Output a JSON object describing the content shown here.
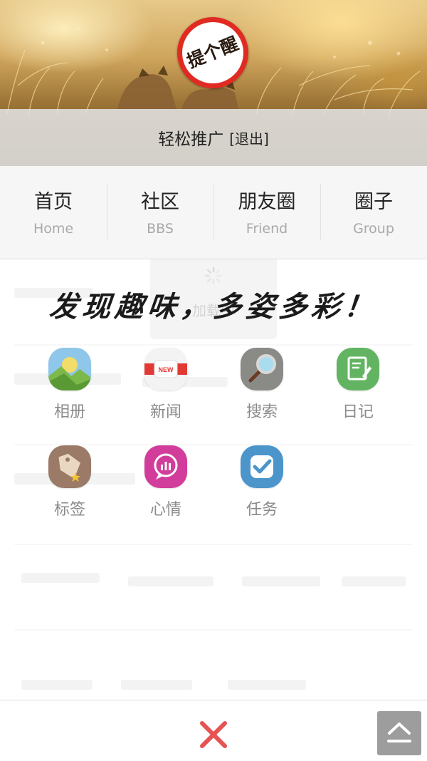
{
  "banner": {
    "stamp_text": "提个醒",
    "username": "轻松推广",
    "logout_label": "[退出]"
  },
  "nav": [
    {
      "cn": "首页",
      "en": "Home"
    },
    {
      "cn": "社区",
      "en": "BBS"
    },
    {
      "cn": "朋友圈",
      "en": "Friend"
    },
    {
      "cn": "圈子",
      "en": "Group"
    }
  ],
  "content": {
    "loading_text": "加载中",
    "slogan": "发现趣味，多姿多彩！"
  },
  "apps": [
    {
      "label": "相册",
      "icon": "photo-album-icon"
    },
    {
      "label": "新闻",
      "icon": "news-icon"
    },
    {
      "label": "搜索",
      "icon": "search-icon"
    },
    {
      "label": "日记",
      "icon": "diary-icon"
    },
    {
      "label": "标签",
      "icon": "tag-icon"
    },
    {
      "label": "心情",
      "icon": "mood-icon"
    },
    {
      "label": "任务",
      "icon": "task-icon"
    }
  ],
  "colors": {
    "stamp_red": "#e02a22",
    "close_red": "#e55353",
    "label_gray": "#8a8a8a"
  }
}
